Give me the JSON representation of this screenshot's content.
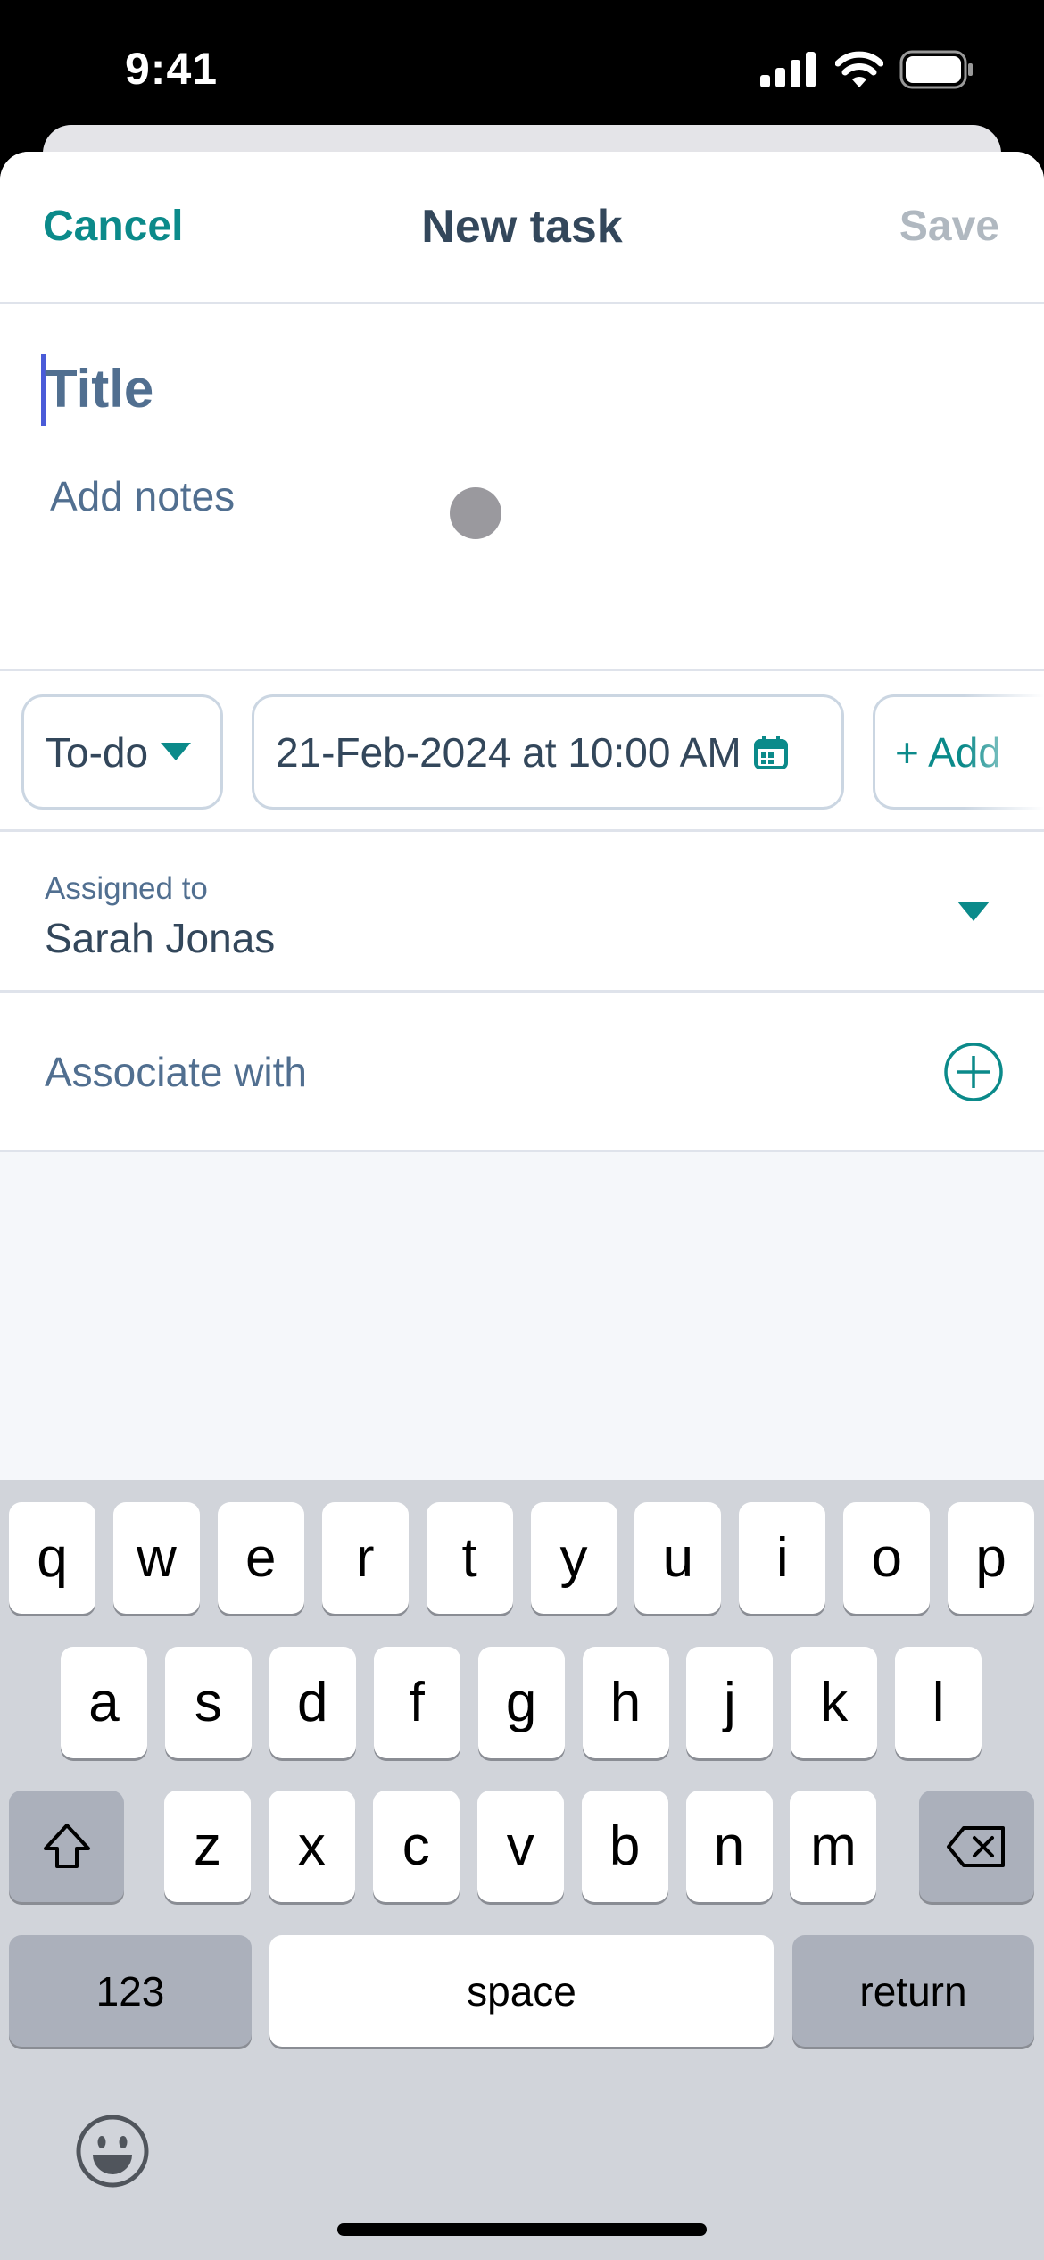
{
  "status_bar": {
    "time": "9:41"
  },
  "header": {
    "cancel_label": "Cancel",
    "title": "New task",
    "save_label": "Save"
  },
  "form": {
    "title_placeholder": "Title",
    "notes_placeholder": "Add notes",
    "status_value": "To-do",
    "due_date_value": "21-Feb-2024 at 10:00 AM",
    "add_label": "+ Add",
    "assigned_label": "Assigned to",
    "assigned_value": "Sarah Jonas",
    "associate_label": "Associate with"
  },
  "colors": {
    "accent": "#0b8a8a",
    "text": "#33475b",
    "disabled": "#b0b8c0",
    "cursor": "#4a5bd8"
  },
  "keyboard": {
    "row1": [
      "q",
      "w",
      "e",
      "r",
      "t",
      "y",
      "u",
      "i",
      "o",
      "p"
    ],
    "row2": [
      "a",
      "s",
      "d",
      "f",
      "g",
      "h",
      "j",
      "k",
      "l"
    ],
    "row3": [
      "z",
      "x",
      "c",
      "v",
      "b",
      "n",
      "m"
    ],
    "numbers_label": "123",
    "space_label": "space",
    "return_label": "return"
  }
}
